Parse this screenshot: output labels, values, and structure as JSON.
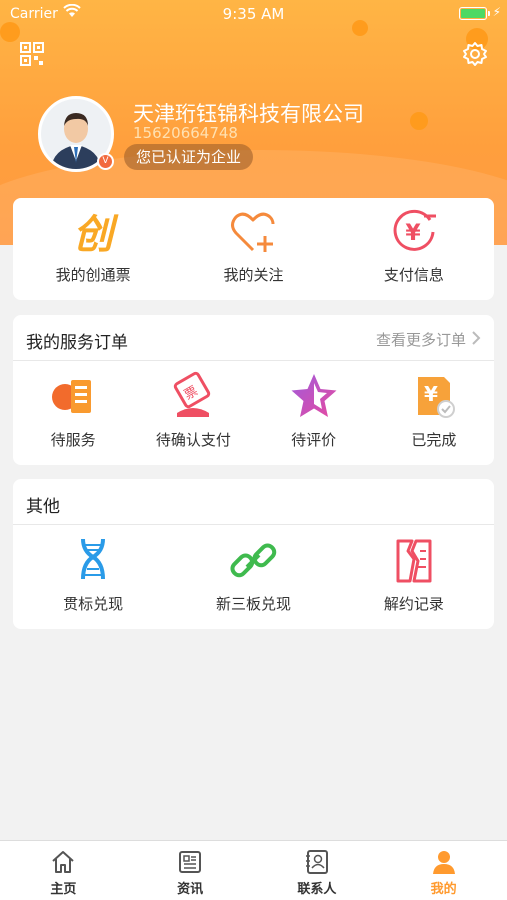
{
  "status_bar": {
    "carrier": "Carrier",
    "time": "9:35 AM"
  },
  "profile": {
    "company": "天津珩钰锦科技有限公司",
    "phone": "15620664748",
    "certification": "您已认证为企业",
    "badge": "V"
  },
  "quick_actions": [
    {
      "label": "我的创通票",
      "icon": "chuang-ticket-icon"
    },
    {
      "label": "我的关注",
      "icon": "heart-plus-icon"
    },
    {
      "label": "支付信息",
      "icon": "yen-circle-icon"
    }
  ],
  "orders": {
    "title": "我的服务订单",
    "more": "查看更多订单",
    "items": [
      {
        "label": "待服务",
        "icon": "service-icon"
      },
      {
        "label": "待确认支付",
        "icon": "payment-confirm-icon"
      },
      {
        "label": "待评价",
        "icon": "star-icon"
      },
      {
        "label": "已完成",
        "icon": "completed-icon"
      }
    ]
  },
  "other": {
    "title": "其他",
    "items": [
      {
        "label": "贯标兑现",
        "icon": "dna-icon"
      },
      {
        "label": "新三板兑现",
        "icon": "link-icon"
      },
      {
        "label": "解约记录",
        "icon": "torn-document-icon"
      }
    ]
  },
  "tabbar": [
    {
      "label": "主页",
      "icon": "home-icon",
      "active": false
    },
    {
      "label": "资讯",
      "icon": "news-icon",
      "active": false
    },
    {
      "label": "联系人",
      "icon": "contacts-icon",
      "active": false
    },
    {
      "label": "我的",
      "icon": "profile-icon",
      "active": true
    }
  ],
  "colors": {
    "accent": "#ff9a2e",
    "header": "#ffa63f",
    "active_tab": "#ff9a2e"
  }
}
